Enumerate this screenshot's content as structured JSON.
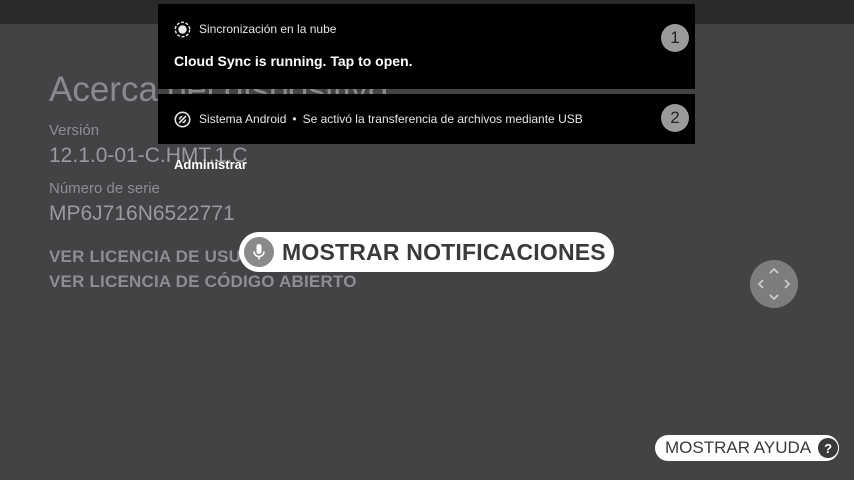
{
  "about": {
    "title": "Acerca del dispositivo",
    "version_label": "Versión",
    "version_value": "12.1.0-01-C.HMT.1.C",
    "serial_label": "Número de serie",
    "serial_value": "MP6J716N6522771",
    "user_license_link": "VER LICENCIA DE USUARIO",
    "open_source_link": "VER LICENCIA DE CÓDIGO ABIERTO"
  },
  "notifications": [
    {
      "app_name": "Sincronización en la nube",
      "body": "Cloud Sync is running. Tap to open.",
      "index": "1",
      "icon": "cloud-sync-icon"
    },
    {
      "app_name": "Sistema Android",
      "separator": "•",
      "text": "Se activó la transferencia de archivos mediante USB",
      "index": "2",
      "icon": "android-system-icon"
    }
  ],
  "manage_action": "Administrar",
  "voice_hint": {
    "label": "MOSTRAR NOTIFICACIONES",
    "icon": "microphone-icon"
  },
  "dpad": {
    "icon": "dpad-navigation-icon"
  },
  "help": {
    "label": "MOSTRAR AYUDA",
    "icon_glyph": "?"
  },
  "colors": {
    "background": "#434346",
    "notification_bg": "#000000",
    "badge": "#9a9a9a",
    "pill": "#ffffff"
  }
}
